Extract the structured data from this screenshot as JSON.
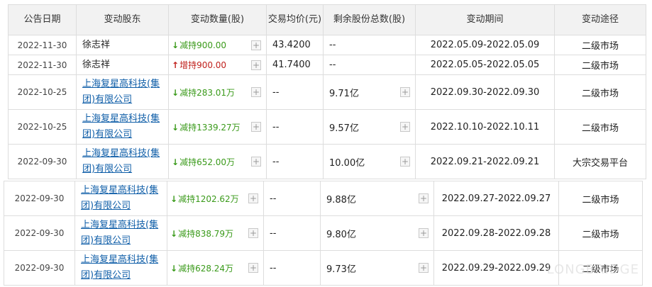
{
  "headers": {
    "date": "公告日期",
    "holder": "变动股东",
    "change": "变动数量(股)",
    "price": "交易均价(元)",
    "remaining": "剩余股份总数(股)",
    "period": "变动期间",
    "route": "变动途径"
  },
  "rows": [
    {
      "date": "2022-11-30",
      "holder": "徐志祥",
      "holder_link": false,
      "direction": "down",
      "change": "减持900.00",
      "price": "43.4200",
      "remaining": "--",
      "period": "2022.05.09-2022.05.09",
      "route": "二级市场"
    },
    {
      "date": "2022-11-30",
      "holder": "徐志祥",
      "holder_link": false,
      "direction": "up",
      "change": "增持900.00",
      "price": "41.7400",
      "remaining": "--",
      "period": "2022.05.05-2022.05.05",
      "route": "二级市场"
    },
    {
      "date": "2022-10-25",
      "holder": "上海复星高科技(集团)有限公司",
      "holder_link": true,
      "direction": "down",
      "change": "减持283.01万",
      "price": "--",
      "remaining": "9.71亿",
      "period": "2022.09.30-2022.09.30",
      "route": "二级市场"
    },
    {
      "date": "2022-10-25",
      "holder": "上海复星高科技(集团)有限公司",
      "holder_link": true,
      "direction": "down",
      "change": "减持1339.27万",
      "price": "--",
      "remaining": "9.57亿",
      "period": "2022.10.10-2022.10.11",
      "route": "二级市场"
    },
    {
      "date": "2022-09-30",
      "holder": "上海复星高科技(集团)有限公司",
      "holder_link": true,
      "direction": "down",
      "change": "减持652.00万",
      "price": "--",
      "remaining": "10.00亿",
      "period": "2022.09.21-2022.09.21",
      "route": "大宗交易平台"
    },
    {
      "date": "2022-09-30",
      "holder": "上海复星高科技(集团)有限公司",
      "holder_link": true,
      "direction": "down",
      "change": "减持1202.62万",
      "price": "--",
      "remaining": "9.88亿",
      "period": "2022.09.27-2022.09.27",
      "route": "二级市场"
    },
    {
      "date": "2022-09-30",
      "holder": "上海复星高科技(集团)有限公司",
      "holder_link": true,
      "direction": "down",
      "change": "减持838.79万",
      "price": "--",
      "remaining": "9.80亿",
      "period": "2022.09.28-2022.09.28",
      "route": "二级市场"
    },
    {
      "date": "2022-09-30",
      "holder": "上海复星高科技(集团)有限公司",
      "holder_link": true,
      "direction": "down",
      "change": "减持628.24万",
      "price": "--",
      "remaining": "9.73亿",
      "period": "2022.09.29-2022.09.29",
      "route": "二级市场"
    }
  ],
  "icons": {
    "down": "down-arrow-icon",
    "up": "up-arrow-icon",
    "expand": "plus-icon"
  },
  "colors": {
    "down": "#3a9a1a",
    "up": "#c0201c",
    "link": "#0f5ea8",
    "header_bg": "#f2f2f2"
  },
  "watermark": "LONGBRIDGE"
}
